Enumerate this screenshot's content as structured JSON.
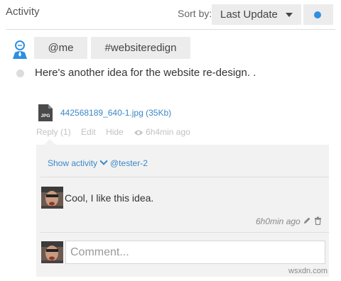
{
  "header": {
    "title": "Activity",
    "sort_label": "Sort by:",
    "sort_value": "Last Update",
    "dot_color": "#2f8fe0"
  },
  "tags": [
    "@me",
    "#websiteredign"
  ],
  "post": {
    "text": "Here's another idea for the website re-design. .",
    "attachment": "442568189_640-1.jpg (35Kb)",
    "file_type": "JPG",
    "actions": {
      "reply": "Reply (1)",
      "edit": "Edit",
      "hide": "Hide",
      "views_time": "6h4min ago"
    }
  },
  "activity": {
    "show_label": "Show activity",
    "mention": "@tester-2",
    "comment": {
      "text": "Cool, I like this idea.",
      "time": "6h0min ago"
    },
    "input_placeholder": "Comment..."
  },
  "watermark": "wsxdn.com",
  "icons": [
    "user-icon",
    "file-icon",
    "eye-icon",
    "chevron-down-icon",
    "pencil-icon",
    "trash-icon"
  ],
  "colors": {
    "link": "#3a87c8",
    "button_bg": "#ececec",
    "panel_bg": "#f2f2f2"
  }
}
